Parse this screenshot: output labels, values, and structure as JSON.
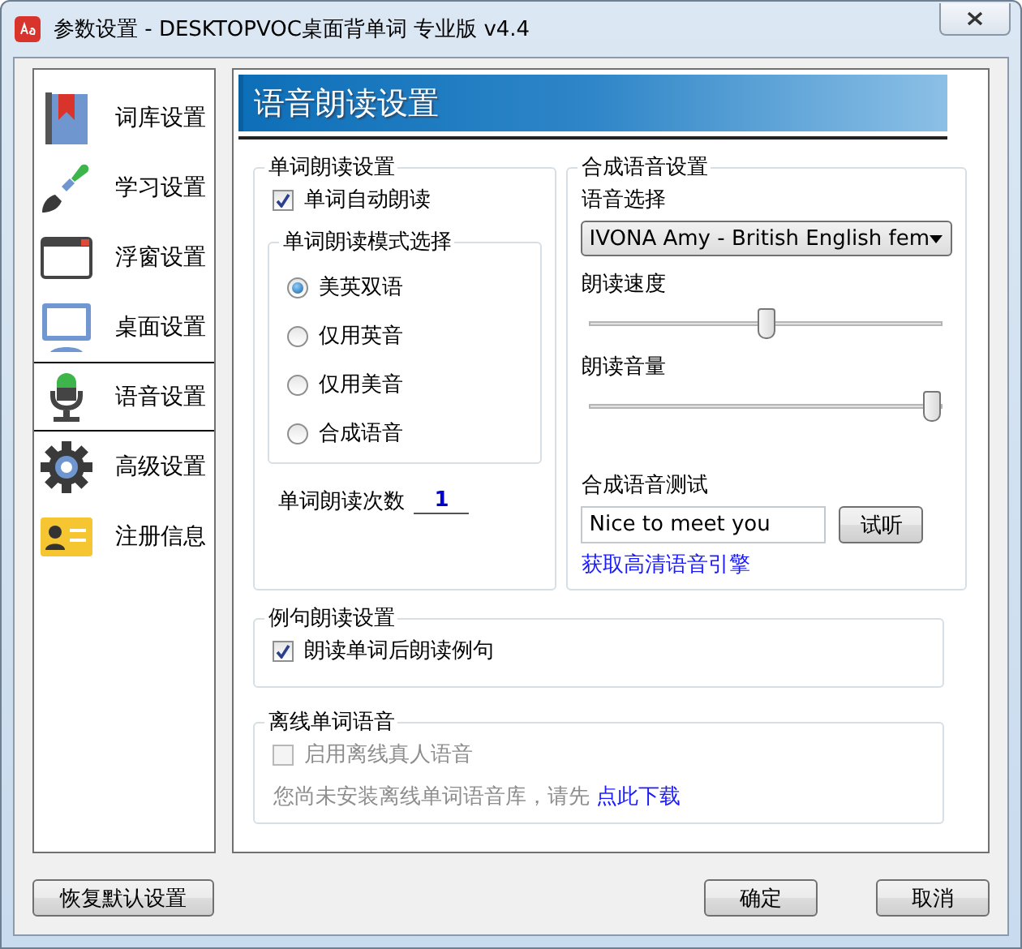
{
  "window": {
    "title": "参数设置 - DESKTOPVOC桌面背单词 专业版 v4.4"
  },
  "sidebar": {
    "items": [
      {
        "label": "词库设置",
        "selected": false
      },
      {
        "label": "学习设置",
        "selected": false
      },
      {
        "label": "浮窗设置",
        "selected": false
      },
      {
        "label": "桌面设置",
        "selected": false
      },
      {
        "label": "语音设置",
        "selected": true
      },
      {
        "label": "高级设置",
        "selected": false
      },
      {
        "label": "注册信息",
        "selected": false
      }
    ]
  },
  "panel": {
    "title": "语音朗读设置",
    "word_reading": {
      "title": "单词朗读设置",
      "auto_read": {
        "label": "单词自动朗读",
        "checked": true
      },
      "mode": {
        "title": "单词朗读模式选择",
        "options": [
          {
            "label": "美英双语",
            "selected": true
          },
          {
            "label": "仅用英音",
            "selected": false
          },
          {
            "label": "仅用美音",
            "selected": false
          },
          {
            "label": "合成语音",
            "selected": false
          }
        ]
      },
      "repeat": {
        "label": "单词朗读次数",
        "value": "1"
      }
    },
    "synth": {
      "title": "合成语音设置",
      "voice_label": "语音选择",
      "voice": "IVONA Amy - British English fem",
      "speed": {
        "label": "朗读速度",
        "level": 0.5
      },
      "volume": {
        "label": "朗读音量",
        "level": 0.97
      },
      "test": {
        "label": "合成语音测试",
        "value": "Nice to meet you",
        "button": "试听"
      },
      "link": "获取高清语音引擎"
    },
    "sentence": {
      "title": "例句朗读设置",
      "checkbox": {
        "label": "朗读单词后朗读例句",
        "checked": true
      }
    },
    "offline": {
      "title": "离线单词语音",
      "checkbox": {
        "label": "启用离线真人语音",
        "checked": false,
        "disabled": true
      },
      "notice": "您尚未安装离线单词语音库，请先",
      "link": "点此下载"
    }
  },
  "buttons": {
    "restore": "恢复默认设置",
    "ok": "确定",
    "cancel": "取消"
  }
}
